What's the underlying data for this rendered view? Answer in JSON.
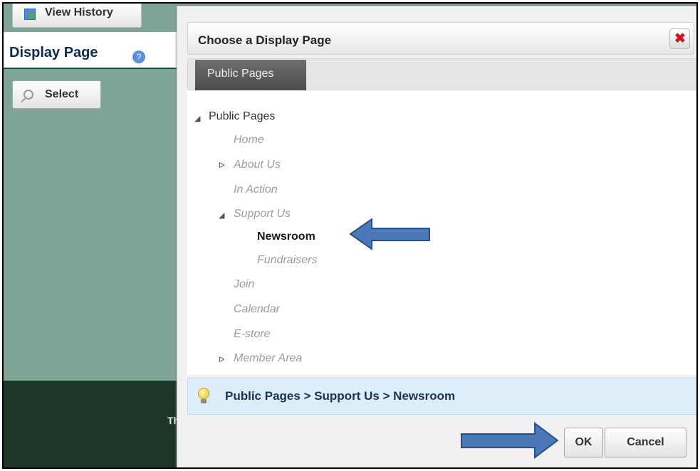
{
  "background": {
    "view_history_label": "View History",
    "display_page_title": "Display Page",
    "help_icon_glyph": "?",
    "select_label": "Select",
    "dark_footer_text": "Th"
  },
  "dialog": {
    "title": "Choose a Display Page",
    "close_glyph": "✖",
    "tab_label": "Public Pages",
    "tree": {
      "root": "Public Pages",
      "items": [
        "Home",
        "About Us",
        "In Action",
        "Support Us",
        "Newsroom",
        "Fundraisers",
        "Join",
        "Calendar",
        "E-store",
        "Member Area"
      ]
    },
    "selected_path": "Public Pages > Support Us > Newsroom",
    "ok_label": "OK",
    "cancel_label": "Cancel"
  },
  "colors": {
    "panel_green": "#7fa597",
    "footer_dark": "#1c3727",
    "tab_dark": "#505050",
    "breadcrumb_bg": "#dceefa",
    "close_red": "#c8171e",
    "arrow_blue": "#4a78b8"
  },
  "icons": {
    "view_history": "history-icon",
    "help": "help-icon",
    "select": "magnifier-icon",
    "close": "close-icon",
    "hint": "lightbulb-icon",
    "expanded": "triangle-expanded-icon",
    "collapsed": "triangle-collapsed-icon"
  }
}
